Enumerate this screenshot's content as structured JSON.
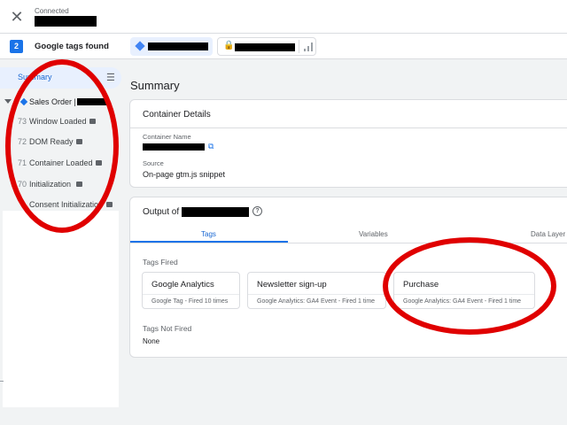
{
  "header": {
    "connected_label": "Connected",
    "tags_count": "2",
    "tags_found_label": "Google tags found"
  },
  "sidebar": {
    "summary_label": "Summary",
    "group_label": "Sales Order |",
    "events": [
      {
        "num": "73",
        "name": "Window Loaded"
      },
      {
        "num": "72",
        "name": "DOM Ready"
      },
      {
        "num": "71",
        "name": "Container Loaded"
      },
      {
        "num": "70",
        "name": "Initialization"
      },
      {
        "num": "",
        "name": "Consent Initialization"
      }
    ]
  },
  "main": {
    "title": "Summary",
    "container_details": {
      "header": "Container Details",
      "name_label": "Container Name",
      "source_label": "Source",
      "source_value": "On-page gtm.js snippet"
    },
    "output": {
      "header_prefix": "Output of",
      "tabs": [
        "Tags",
        "Variables",
        "Data Layer"
      ],
      "tags_fired_label": "Tags Fired",
      "tags_fired": [
        {
          "name": "Google Analytics",
          "desc": "Google Tag - Fired 10 times"
        },
        {
          "name": "Newsletter sign-up",
          "desc": "Google Analytics: GA4 Event - Fired 1 time"
        },
        {
          "name": "Purchase",
          "desc": "Google Analytics: GA4 Event - Fired 1 time"
        }
      ],
      "tags_not_fired_label": "Tags Not Fired",
      "tags_not_fired_value": "None"
    }
  },
  "colors": {
    "accent": "#1a73e8",
    "annotation": "#e00000"
  },
  "icons": [
    "close-icon",
    "tag-diamond-icon",
    "lock-icon",
    "signal-icon",
    "delete-sweep-icon",
    "caret-down-icon",
    "open-in-new-icon",
    "help-icon"
  ]
}
